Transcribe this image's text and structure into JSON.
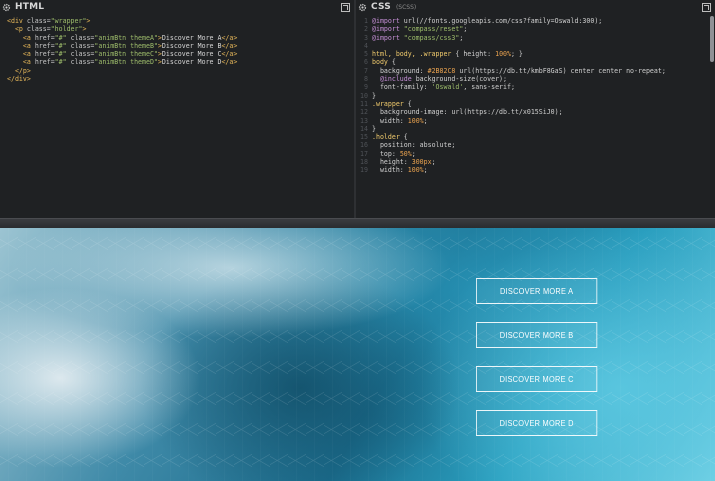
{
  "html_pane": {
    "title": "HTML",
    "lines": [
      [
        {
          "c": "tag",
          "t": "<div "
        },
        {
          "c": "attr",
          "t": "class="
        },
        {
          "c": "str",
          "t": "\"wrapper\""
        },
        {
          "c": "tag",
          "t": ">"
        }
      ],
      [
        {
          "c": "plain",
          "t": "  "
        },
        {
          "c": "tag",
          "t": "<p "
        },
        {
          "c": "attr",
          "t": "class="
        },
        {
          "c": "str",
          "t": "\"holder\""
        },
        {
          "c": "tag",
          "t": ">"
        }
      ],
      [
        {
          "c": "plain",
          "t": "    "
        },
        {
          "c": "tag",
          "t": "<a "
        },
        {
          "c": "attr",
          "t": "href="
        },
        {
          "c": "str",
          "t": "\"#\""
        },
        {
          "c": "attr",
          "t": " class="
        },
        {
          "c": "str",
          "t": "\"animBtn themeA\""
        },
        {
          "c": "tag",
          "t": ">"
        },
        {
          "c": "txt",
          "t": "Discover More A"
        },
        {
          "c": "tag",
          "t": "</a>"
        }
      ],
      [
        {
          "c": "plain",
          "t": "    "
        },
        {
          "c": "tag",
          "t": "<a "
        },
        {
          "c": "attr",
          "t": "href="
        },
        {
          "c": "str",
          "t": "\"#\""
        },
        {
          "c": "attr",
          "t": " class="
        },
        {
          "c": "str",
          "t": "\"animBtn themeB\""
        },
        {
          "c": "tag",
          "t": ">"
        },
        {
          "c": "txt",
          "t": "Discover More B"
        },
        {
          "c": "tag",
          "t": "</a>"
        }
      ],
      [
        {
          "c": "plain",
          "t": "    "
        },
        {
          "c": "tag",
          "t": "<a "
        },
        {
          "c": "attr",
          "t": "href="
        },
        {
          "c": "str",
          "t": "\"#\""
        },
        {
          "c": "attr",
          "t": " class="
        },
        {
          "c": "str",
          "t": "\"animBtn themeC\""
        },
        {
          "c": "tag",
          "t": ">"
        },
        {
          "c": "txt",
          "t": "Discover More C"
        },
        {
          "c": "tag",
          "t": "</a>"
        }
      ],
      [
        {
          "c": "plain",
          "t": "    "
        },
        {
          "c": "tag",
          "t": "<a "
        },
        {
          "c": "attr",
          "t": "href="
        },
        {
          "c": "str",
          "t": "\"#\""
        },
        {
          "c": "attr",
          "t": " class="
        },
        {
          "c": "str",
          "t": "\"animBtn themeD\""
        },
        {
          "c": "tag",
          "t": ">"
        },
        {
          "c": "txt",
          "t": "Discover More D"
        },
        {
          "c": "tag",
          "t": "</a>"
        }
      ],
      [
        {
          "c": "plain",
          "t": "  "
        },
        {
          "c": "tag",
          "t": "</p>"
        }
      ],
      [
        {
          "c": "tag",
          "t": "</div>"
        }
      ]
    ]
  },
  "css_pane": {
    "title": "CSS",
    "subtitle": "(SCSS)",
    "lines": [
      {
        "n": "1",
        "parts": [
          {
            "c": "kw",
            "t": "@import "
          },
          {
            "c": "plain",
            "t": "url(//fonts.googleapis.com/css?family=Oswald:300);"
          }
        ]
      },
      {
        "n": "2",
        "parts": [
          {
            "c": "kw",
            "t": "@import "
          },
          {
            "c": "str",
            "t": "\"compass/reset\""
          },
          {
            "c": "plain",
            "t": ";"
          }
        ]
      },
      {
        "n": "3",
        "parts": [
          {
            "c": "kw",
            "t": "@import "
          },
          {
            "c": "str",
            "t": "\"compass/css3\""
          },
          {
            "c": "plain",
            "t": ";"
          }
        ]
      },
      {
        "n": "4",
        "parts": []
      },
      {
        "n": "5",
        "parts": [
          {
            "c": "sel",
            "t": "html, body, .wrapper "
          },
          {
            "c": "plain",
            "t": "{ "
          },
          {
            "c": "prop",
            "t": "height: "
          },
          {
            "c": "val",
            "t": "100%"
          },
          {
            "c": "plain",
            "t": "; }"
          }
        ]
      },
      {
        "n": "6",
        "parts": [
          {
            "c": "sel",
            "t": "body "
          },
          {
            "c": "plain",
            "t": "{"
          }
        ]
      },
      {
        "n": "7",
        "parts": [
          {
            "c": "plain",
            "t": "  "
          },
          {
            "c": "prop",
            "t": "background: "
          },
          {
            "c": "val",
            "t": "#2B82C8 "
          },
          {
            "c": "plain",
            "t": "url(https://db.tt/kmbF8GaS) center center no-repeat;"
          }
        ]
      },
      {
        "n": "8",
        "parts": [
          {
            "c": "plain",
            "t": "  "
          },
          {
            "c": "kw",
            "t": "@include "
          },
          {
            "c": "plain",
            "t": "background-size(cover);"
          }
        ]
      },
      {
        "n": "9",
        "parts": [
          {
            "c": "plain",
            "t": "  "
          },
          {
            "c": "prop",
            "t": "font-family: "
          },
          {
            "c": "str",
            "t": "'Oswald'"
          },
          {
            "c": "plain",
            "t": ", sans-serif;"
          }
        ]
      },
      {
        "n": "10",
        "parts": [
          {
            "c": "plain",
            "t": "}"
          }
        ]
      },
      {
        "n": "11",
        "parts": [
          {
            "c": "sel",
            "t": ".wrapper "
          },
          {
            "c": "plain",
            "t": "{"
          }
        ]
      },
      {
        "n": "12",
        "parts": [
          {
            "c": "plain",
            "t": "  "
          },
          {
            "c": "prop",
            "t": "background-image: "
          },
          {
            "c": "plain",
            "t": "url(https://db.tt/x015SiJ0);"
          }
        ]
      },
      {
        "n": "13",
        "parts": [
          {
            "c": "plain",
            "t": "  "
          },
          {
            "c": "prop",
            "t": "width: "
          },
          {
            "c": "val",
            "t": "100%"
          },
          {
            "c": "plain",
            "t": ";"
          }
        ]
      },
      {
        "n": "14",
        "parts": [
          {
            "c": "plain",
            "t": "}"
          }
        ]
      },
      {
        "n": "15",
        "parts": [
          {
            "c": "sel",
            "t": ".holder "
          },
          {
            "c": "plain",
            "t": "{"
          }
        ]
      },
      {
        "n": "16",
        "parts": [
          {
            "c": "plain",
            "t": "  "
          },
          {
            "c": "prop",
            "t": "position: "
          },
          {
            "c": "plain",
            "t": "absolute;"
          }
        ]
      },
      {
        "n": "17",
        "parts": [
          {
            "c": "plain",
            "t": "  "
          },
          {
            "c": "prop",
            "t": "top: "
          },
          {
            "c": "val",
            "t": "50%"
          },
          {
            "c": "plain",
            "t": ";"
          }
        ]
      },
      {
        "n": "18",
        "parts": [
          {
            "c": "plain",
            "t": "  "
          },
          {
            "c": "prop",
            "t": "height: "
          },
          {
            "c": "val",
            "t": "300px"
          },
          {
            "c": "plain",
            "t": ";"
          }
        ]
      },
      {
        "n": "19",
        "parts": [
          {
            "c": "plain",
            "t": "  "
          },
          {
            "c": "prop",
            "t": "width: "
          },
          {
            "c": "val",
            "t": "100%"
          },
          {
            "c": "plain",
            "t": ";"
          }
        ]
      }
    ]
  },
  "preview": {
    "buttons": [
      {
        "label": "DISCOVER MORE A"
      },
      {
        "label": "DISCOVER MORE B"
      },
      {
        "label": "DISCOVER MORE C"
      },
      {
        "label": "DISCOVER MORE D"
      }
    ]
  }
}
